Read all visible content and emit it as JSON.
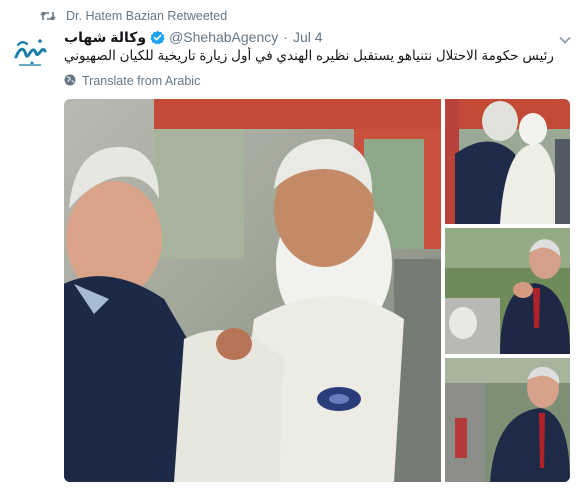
{
  "retweet": {
    "text": "Dr. Hatem Bazian Retweeted",
    "icon": "retweet-icon"
  },
  "author": {
    "display_name": "وكالة شهاب",
    "handle": "@ShehabAgency",
    "separator": "·",
    "date": "Jul 4",
    "verified_icon": "verified-badge-icon",
    "avatar_icon": "shehab-logo-avatar"
  },
  "tweet": {
    "text": "رئيس حكومة الاحتلال نتنياهو يستقبل نظيره الهندي في أول زيارة تاريخية للكيان الصهيوني"
  },
  "translate": {
    "label": "Translate from Arabic",
    "icon": "globe-icon"
  },
  "media": {
    "photos": [
      {
        "name": "main-photo"
      },
      {
        "name": "photo-hug"
      },
      {
        "name": "photo-applause"
      },
      {
        "name": "photo-seated"
      }
    ]
  },
  "colors": {
    "secondary_text": "#657786",
    "verified_blue": "#1da1f2",
    "primary_text": "#14171a",
    "logo_teal": "#1a7fa8"
  }
}
